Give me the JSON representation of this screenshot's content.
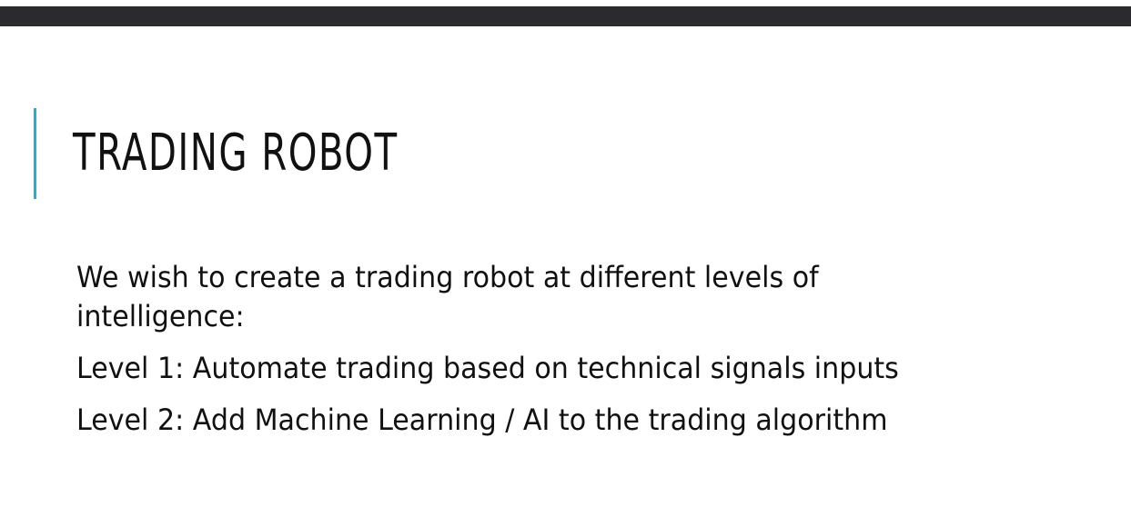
{
  "slide": {
    "title": "TRADING ROBOT",
    "paragraphs": [
      "We wish to create a trading robot at different levels of intelligence:",
      "Level 1: Automate trading based on technical signals inputs",
      "Level 2: Add Machine Learning / AI to the trading algorithm"
    ]
  },
  "colors": {
    "top_bar": "#2b2b2f",
    "accent_line": "#3aa6c8",
    "text": "#111111",
    "background": "#ffffff"
  }
}
